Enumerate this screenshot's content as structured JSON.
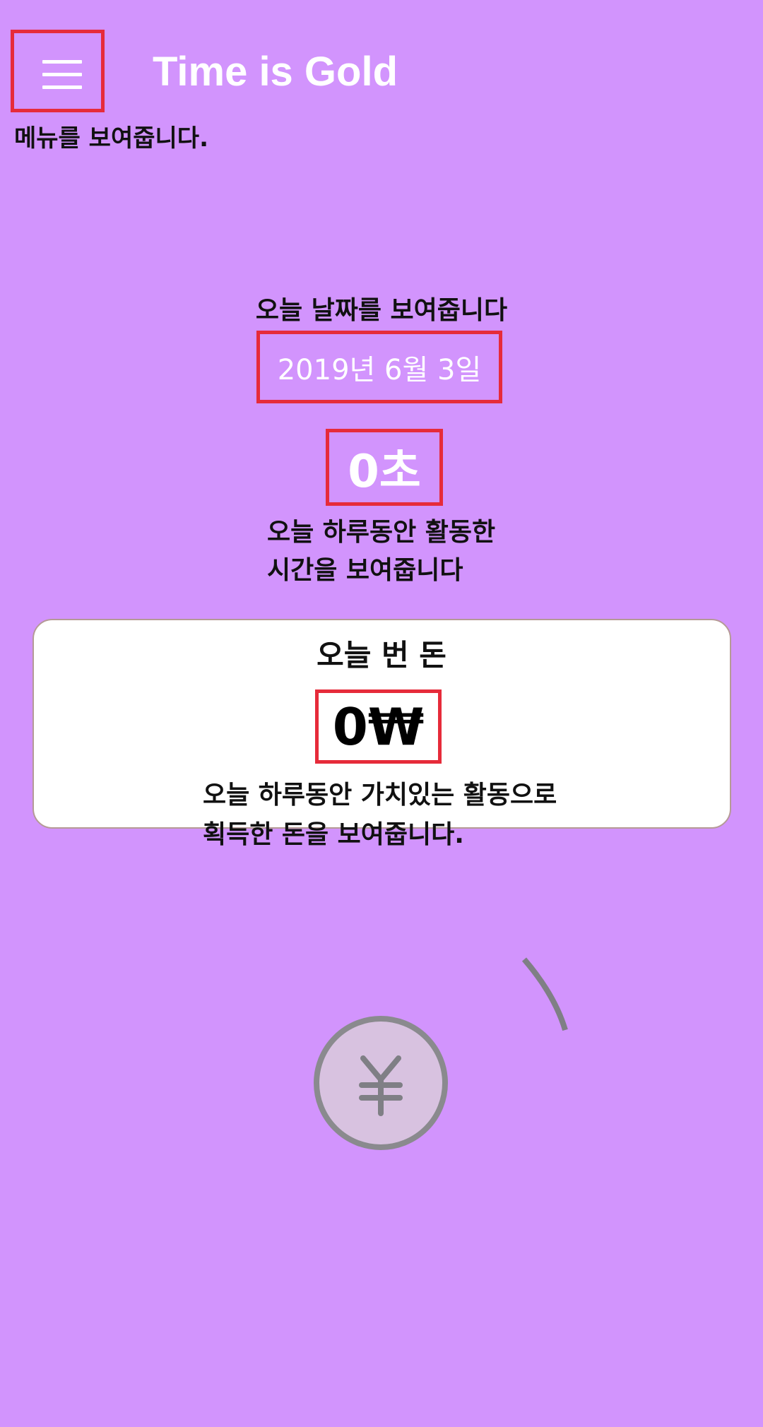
{
  "header": {
    "title": "Time is Gold",
    "menu_note": "메뉴를 보여줍니다."
  },
  "date_section": {
    "note": "오늘 날짜를 보여줍니다",
    "date": "2019년  6월  3일"
  },
  "time_section": {
    "value": "0초",
    "note_line1": "오늘 하루동안 활동한",
    "note_line2": "시간을 보여줍니다"
  },
  "money_section": {
    "title": "오늘 번 돈",
    "value": "0₩",
    "note_line1": "오늘 하루동안 가치있는 활동으로",
    "note_line2": "획득한 돈을 보여줍니다."
  },
  "colors": {
    "background": "#d294fd",
    "highlight_border": "#e62b3a",
    "card_background": "#ffffff",
    "button_fill": "#d8c2e0",
    "button_border": "#8a8a8e"
  },
  "icons": {
    "menu": "hamburger-menu-icon",
    "main_button": "yen-icon",
    "loading": "spinner-arc-icon"
  }
}
